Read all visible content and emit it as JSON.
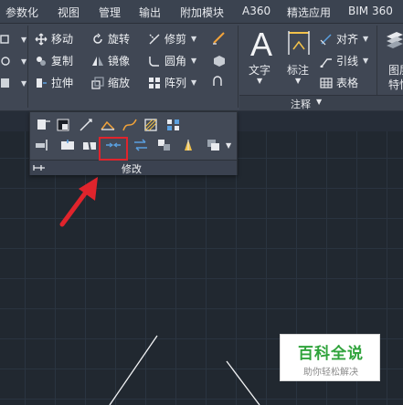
{
  "menu": {
    "items": [
      "参数化",
      "视图",
      "管理",
      "输出",
      "附加模块",
      "A360",
      "精选应用",
      "BIM 360"
    ]
  },
  "ribbon": {
    "modify_row1": [
      "移动",
      "旋转",
      "修剪"
    ],
    "modify_row2": [
      "复制",
      "镜像",
      "圆角"
    ],
    "modify_row3": [
      "拉伸",
      "缩放",
      "阵列"
    ],
    "text_label": "文字",
    "dim_label": "标注",
    "big_a": "A",
    "annot_items": [
      "对齐",
      "引线",
      "表格"
    ],
    "annot_footer": "注释",
    "right_partial": [
      "图层",
      "特性"
    ]
  },
  "modify_panel": {
    "footer_label": "修改",
    "highlighted_tool": "join-tool"
  },
  "watermark": {
    "title": "百科全说",
    "subtitle": "助你轻松解决"
  },
  "colors": {
    "highlight": "#e0242c",
    "watermark_green": "#2fa33b",
    "canvas": "#212830"
  }
}
